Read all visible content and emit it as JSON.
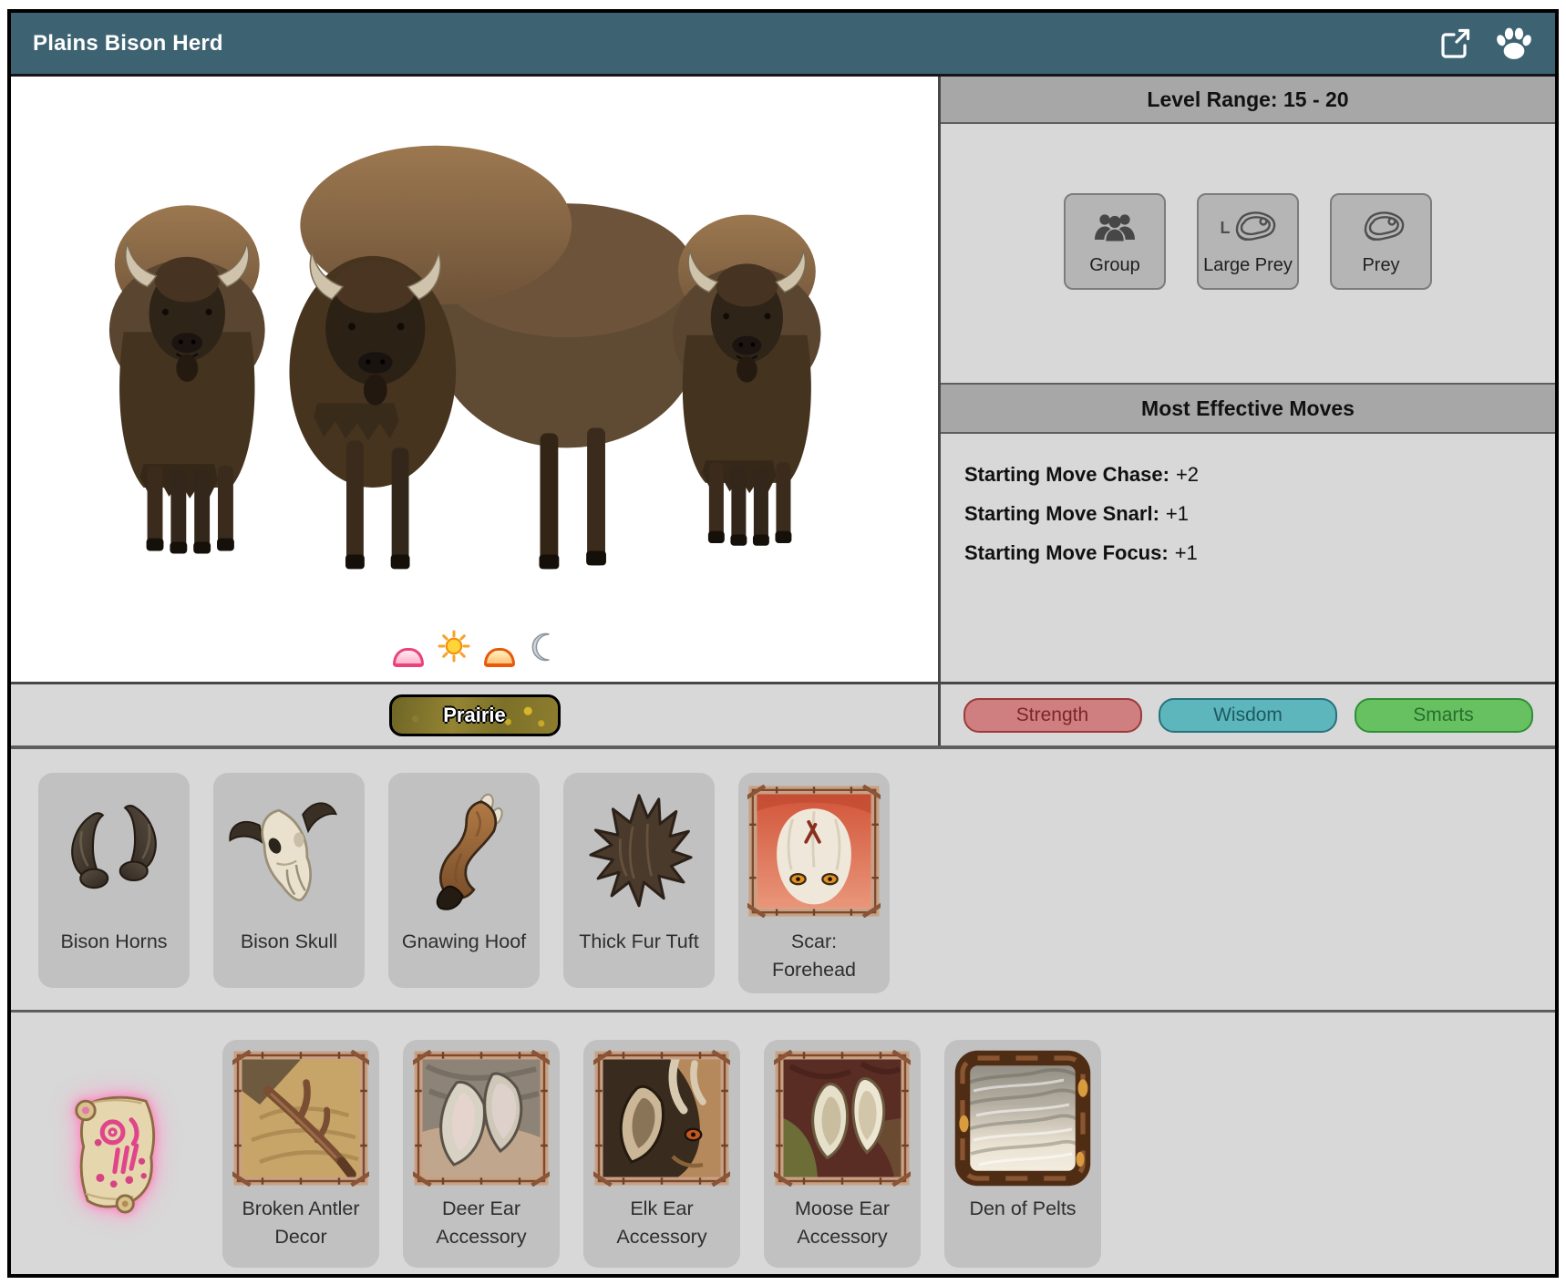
{
  "title": "Plains Bison Herd",
  "colors": {
    "titlebar_teal": "#3d6272",
    "panel_gray": "#d8d8d8",
    "header_gray": "#a7a7a7",
    "card_gray": "#c1c1c1",
    "strength_red": "#cf7f7f",
    "wisdom_teal": "#5cb6bc",
    "smarts_green": "#67c161"
  },
  "level_panel": {
    "header": "Level Range: 15 - 20",
    "tags": [
      {
        "label": "Group",
        "icon": "group-icon"
      },
      {
        "label": "Large Prey",
        "icon": "steak-icon",
        "icon_letter": "L"
      },
      {
        "label": "Prey",
        "icon": "steak-icon"
      }
    ]
  },
  "moves": {
    "header": "Most Effective Moves",
    "list": [
      {
        "label": "Starting Move Chase:",
        "value": "+2"
      },
      {
        "label": "Starting Move Snarl:",
        "value": "+1"
      },
      {
        "label": "Starting Move Focus:",
        "value": "+1"
      }
    ]
  },
  "stage": {
    "artwork": "three-plains-bison-illustration",
    "times_of_day": [
      "dawn",
      "day",
      "dusk",
      "night"
    ]
  },
  "habitat": {
    "label": "Prairie"
  },
  "stat_pills": [
    {
      "label": "Strength",
      "color": "#cf7f7f"
    },
    {
      "label": "Wisdom",
      "color": "#5cb6bc"
    },
    {
      "label": "Smarts",
      "color": "#67c161"
    }
  ],
  "drops": [
    {
      "label": "Bison Horns"
    },
    {
      "label": "Bison Skull"
    },
    {
      "label": "Gnawing Hoof"
    },
    {
      "label": "Thick Fur Tuft"
    },
    {
      "label": "Scar: Forehead"
    }
  ],
  "unlocks": [
    {
      "label": "Broken Antler Decor"
    },
    {
      "label": "Deer Ear Accessory"
    },
    {
      "label": "Elk Ear Accessory"
    },
    {
      "label": "Moose Ear Accessory"
    },
    {
      "label": "Den of Pelts"
    }
  ]
}
